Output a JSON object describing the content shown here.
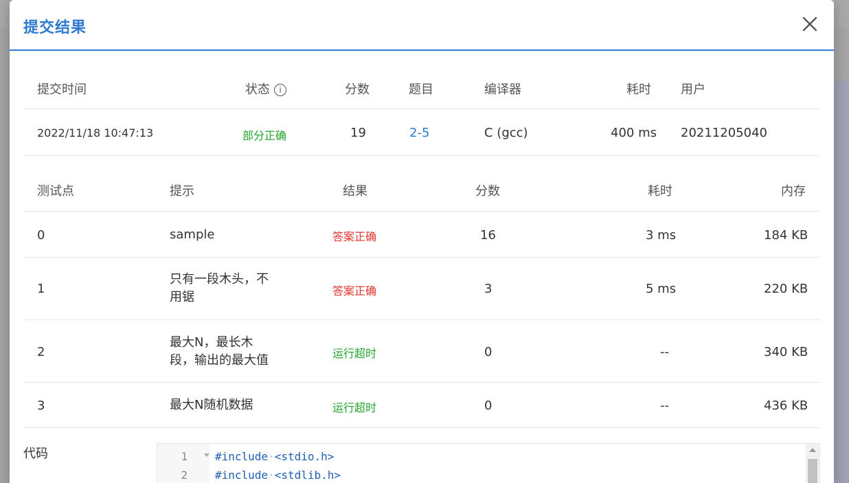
{
  "modal": {
    "title": "提交结果"
  },
  "summary": {
    "headers": [
      "提交时间",
      "状态",
      "分数",
      "题目",
      "编译器",
      "耗时",
      "用户"
    ],
    "info_icon": "info-circle-icon",
    "row": {
      "time": "2022/11/18 10:47:13",
      "status": "部分正确",
      "score": "19",
      "problem": "2-5",
      "compiler": "C (gcc)",
      "elapsed": "400 ms",
      "user": "20211205040"
    }
  },
  "cases": {
    "headers": [
      "测试点",
      "提示",
      "结果",
      "分数",
      "耗时",
      "内存"
    ],
    "rows": [
      {
        "id": "0",
        "hint": "sample",
        "result": "答案正确",
        "score": "16",
        "time": "3 ms",
        "memory": "184 KB"
      },
      {
        "id": "1",
        "hint": "只有一段木头，不用锯",
        "result": "答案正确",
        "score": "3",
        "time": "5 ms",
        "memory": "220 KB"
      },
      {
        "id": "2",
        "hint": "最大N，最长木段，输出的最大值",
        "result": "运行超时",
        "score": "0",
        "time": "--",
        "memory": "340 KB"
      },
      {
        "id": "3",
        "hint": "最大N随机数据",
        "result": "运行超时",
        "score": "0",
        "time": "--",
        "memory": "436 KB"
      }
    ]
  },
  "code": {
    "label": "代码",
    "lines": [
      {
        "num": "1",
        "directive": "#include",
        "header": "<stdio.h>"
      },
      {
        "num": "2",
        "directive": "#include",
        "header": "<stdlib.h>"
      }
    ]
  },
  "colors": {
    "accent": "#2e7ad1",
    "ok": "#23a32c",
    "error": "#e3342f"
  }
}
